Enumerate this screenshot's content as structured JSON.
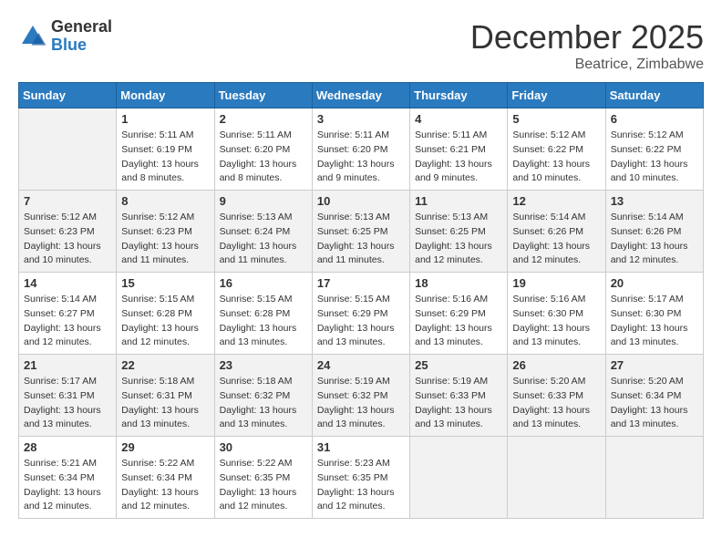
{
  "logo": {
    "general": "General",
    "blue": "Blue"
  },
  "title": {
    "month": "December 2025",
    "location": "Beatrice, Zimbabwe"
  },
  "weekdays": [
    "Sunday",
    "Monday",
    "Tuesday",
    "Wednesday",
    "Thursday",
    "Friday",
    "Saturday"
  ],
  "weeks": [
    [
      {
        "day": "",
        "info": ""
      },
      {
        "day": "1",
        "info": "Sunrise: 5:11 AM\nSunset: 6:19 PM\nDaylight: 13 hours\nand 8 minutes."
      },
      {
        "day": "2",
        "info": "Sunrise: 5:11 AM\nSunset: 6:20 PM\nDaylight: 13 hours\nand 8 minutes."
      },
      {
        "day": "3",
        "info": "Sunrise: 5:11 AM\nSunset: 6:20 PM\nDaylight: 13 hours\nand 9 minutes."
      },
      {
        "day": "4",
        "info": "Sunrise: 5:11 AM\nSunset: 6:21 PM\nDaylight: 13 hours\nand 9 minutes."
      },
      {
        "day": "5",
        "info": "Sunrise: 5:12 AM\nSunset: 6:22 PM\nDaylight: 13 hours\nand 10 minutes."
      },
      {
        "day": "6",
        "info": "Sunrise: 5:12 AM\nSunset: 6:22 PM\nDaylight: 13 hours\nand 10 minutes."
      }
    ],
    [
      {
        "day": "7",
        "info": "Sunrise: 5:12 AM\nSunset: 6:23 PM\nDaylight: 13 hours\nand 10 minutes."
      },
      {
        "day": "8",
        "info": "Sunrise: 5:12 AM\nSunset: 6:23 PM\nDaylight: 13 hours\nand 11 minutes."
      },
      {
        "day": "9",
        "info": "Sunrise: 5:13 AM\nSunset: 6:24 PM\nDaylight: 13 hours\nand 11 minutes."
      },
      {
        "day": "10",
        "info": "Sunrise: 5:13 AM\nSunset: 6:25 PM\nDaylight: 13 hours\nand 11 minutes."
      },
      {
        "day": "11",
        "info": "Sunrise: 5:13 AM\nSunset: 6:25 PM\nDaylight: 13 hours\nand 12 minutes."
      },
      {
        "day": "12",
        "info": "Sunrise: 5:14 AM\nSunset: 6:26 PM\nDaylight: 13 hours\nand 12 minutes."
      },
      {
        "day": "13",
        "info": "Sunrise: 5:14 AM\nSunset: 6:26 PM\nDaylight: 13 hours\nand 12 minutes."
      }
    ],
    [
      {
        "day": "14",
        "info": "Sunrise: 5:14 AM\nSunset: 6:27 PM\nDaylight: 13 hours\nand 12 minutes."
      },
      {
        "day": "15",
        "info": "Sunrise: 5:15 AM\nSunset: 6:28 PM\nDaylight: 13 hours\nand 12 minutes."
      },
      {
        "day": "16",
        "info": "Sunrise: 5:15 AM\nSunset: 6:28 PM\nDaylight: 13 hours\nand 13 minutes."
      },
      {
        "day": "17",
        "info": "Sunrise: 5:15 AM\nSunset: 6:29 PM\nDaylight: 13 hours\nand 13 minutes."
      },
      {
        "day": "18",
        "info": "Sunrise: 5:16 AM\nSunset: 6:29 PM\nDaylight: 13 hours\nand 13 minutes."
      },
      {
        "day": "19",
        "info": "Sunrise: 5:16 AM\nSunset: 6:30 PM\nDaylight: 13 hours\nand 13 minutes."
      },
      {
        "day": "20",
        "info": "Sunrise: 5:17 AM\nSunset: 6:30 PM\nDaylight: 13 hours\nand 13 minutes."
      }
    ],
    [
      {
        "day": "21",
        "info": "Sunrise: 5:17 AM\nSunset: 6:31 PM\nDaylight: 13 hours\nand 13 minutes."
      },
      {
        "day": "22",
        "info": "Sunrise: 5:18 AM\nSunset: 6:31 PM\nDaylight: 13 hours\nand 13 minutes."
      },
      {
        "day": "23",
        "info": "Sunrise: 5:18 AM\nSunset: 6:32 PM\nDaylight: 13 hours\nand 13 minutes."
      },
      {
        "day": "24",
        "info": "Sunrise: 5:19 AM\nSunset: 6:32 PM\nDaylight: 13 hours\nand 13 minutes."
      },
      {
        "day": "25",
        "info": "Sunrise: 5:19 AM\nSunset: 6:33 PM\nDaylight: 13 hours\nand 13 minutes."
      },
      {
        "day": "26",
        "info": "Sunrise: 5:20 AM\nSunset: 6:33 PM\nDaylight: 13 hours\nand 13 minutes."
      },
      {
        "day": "27",
        "info": "Sunrise: 5:20 AM\nSunset: 6:34 PM\nDaylight: 13 hours\nand 13 minutes."
      }
    ],
    [
      {
        "day": "28",
        "info": "Sunrise: 5:21 AM\nSunset: 6:34 PM\nDaylight: 13 hours\nand 12 minutes."
      },
      {
        "day": "29",
        "info": "Sunrise: 5:22 AM\nSunset: 6:34 PM\nDaylight: 13 hours\nand 12 minutes."
      },
      {
        "day": "30",
        "info": "Sunrise: 5:22 AM\nSunset: 6:35 PM\nDaylight: 13 hours\nand 12 minutes."
      },
      {
        "day": "31",
        "info": "Sunrise: 5:23 AM\nSunset: 6:35 PM\nDaylight: 13 hours\nand 12 minutes."
      },
      {
        "day": "",
        "info": ""
      },
      {
        "day": "",
        "info": ""
      },
      {
        "day": "",
        "info": ""
      }
    ]
  ]
}
